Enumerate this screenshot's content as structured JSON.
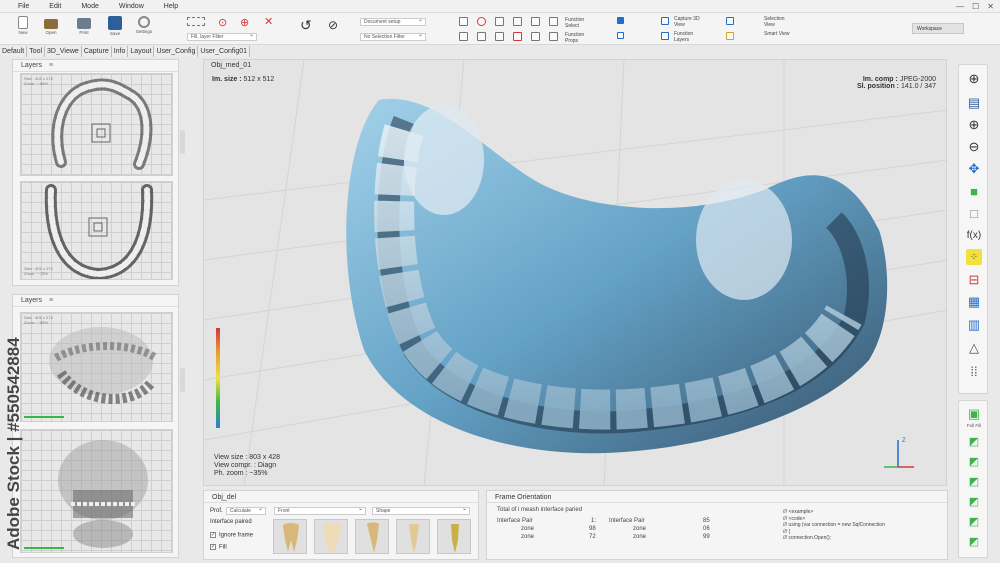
{
  "menu": [
    "File",
    "Edit",
    "Mode",
    "Window",
    "Help"
  ],
  "toolbar": {
    "new_label": "New",
    "open_label": "Open",
    "print_label": "Print",
    "save_label": "Save",
    "settings_label": "Settings",
    "layer_filter": "Fill, layer Filter",
    "document_setup": "Document setup",
    "selection_filter": "No Selection Filter",
    "function_select": "Function Select",
    "function_props": "Function Props",
    "capture_3d": "Capture 3D View",
    "function_layers": "Function Layers",
    "selection_view": "Selection View",
    "smart_view": "Smart View",
    "workspace": "Workspace"
  },
  "tabs": [
    "Default",
    "Tool",
    "3D_Viewe",
    "Capture",
    "Info",
    "Layout",
    "User_Config",
    "User_Config01"
  ],
  "layers_panel_1": {
    "title": "Layers",
    "thumb1_info": [
      "Size : 401 x 274",
      "Zoom : ~85%"
    ],
    "thumb2_info": [
      "Size : 401 x 274",
      "Zoom : ~78%"
    ]
  },
  "layers_panel_2": {
    "title": "Layers",
    "thumb1_info": [
      "Size : 401 x 274",
      "Zoom : ~85%"
    ],
    "thumb2_info": [
      "Size : 401 x 274",
      "Zoom : ~78%"
    ]
  },
  "viewport": {
    "title": "Obj_med_01",
    "im_size_label": "Im. size :",
    "im_size_value": "512 x 512",
    "im_comp_label": "Im. comp :",
    "im_comp_value": "JPEG-2000",
    "sl_position_label": "Sl. position :",
    "sl_position_value": "141.0 / 347",
    "view_size": "View size : 803 x 428",
    "view_compr": "View compr. : Diagn",
    "ph_zoom": "Ph. zoom : ~35%",
    "axis_z": "Z"
  },
  "obj_panel": {
    "title": "Obj_del",
    "prof_label": "Prof.",
    "prof_value": "Calculate",
    "front_value": "Front",
    "shape_value": "Shape",
    "interface_label": "Interface paired",
    "ignore_frame": "Ignore frame",
    "fill": "Fill"
  },
  "frame_panel": {
    "title": "Frame Orientation",
    "total": "Total of i meash interface paried",
    "rows": [
      {
        "a": "Interface Pair",
        "b": "1:",
        "c": "Interface Pair",
        "d": "85"
      },
      {
        "a": "zone",
        "b": "98",
        "c": "zone",
        "d": "06"
      },
      {
        "a": "zone",
        "b": "72",
        "c": "zone",
        "d": "99"
      }
    ],
    "code": [
      "/// <example>",
      "/// <code>",
      "/// using (var connection = new SqlConnection",
      "/// {",
      "///     connection.Open();"
    ]
  },
  "right_panel": {
    "full_fill": "Full Fill"
  },
  "watermark": "Adobe Stock | #550542884",
  "colors": {
    "accent_green": "#3bb54a",
    "scan_blue": "#6fb4d8",
    "red_icon": "#d03a3a",
    "blue_icon": "#1f6fd0"
  }
}
